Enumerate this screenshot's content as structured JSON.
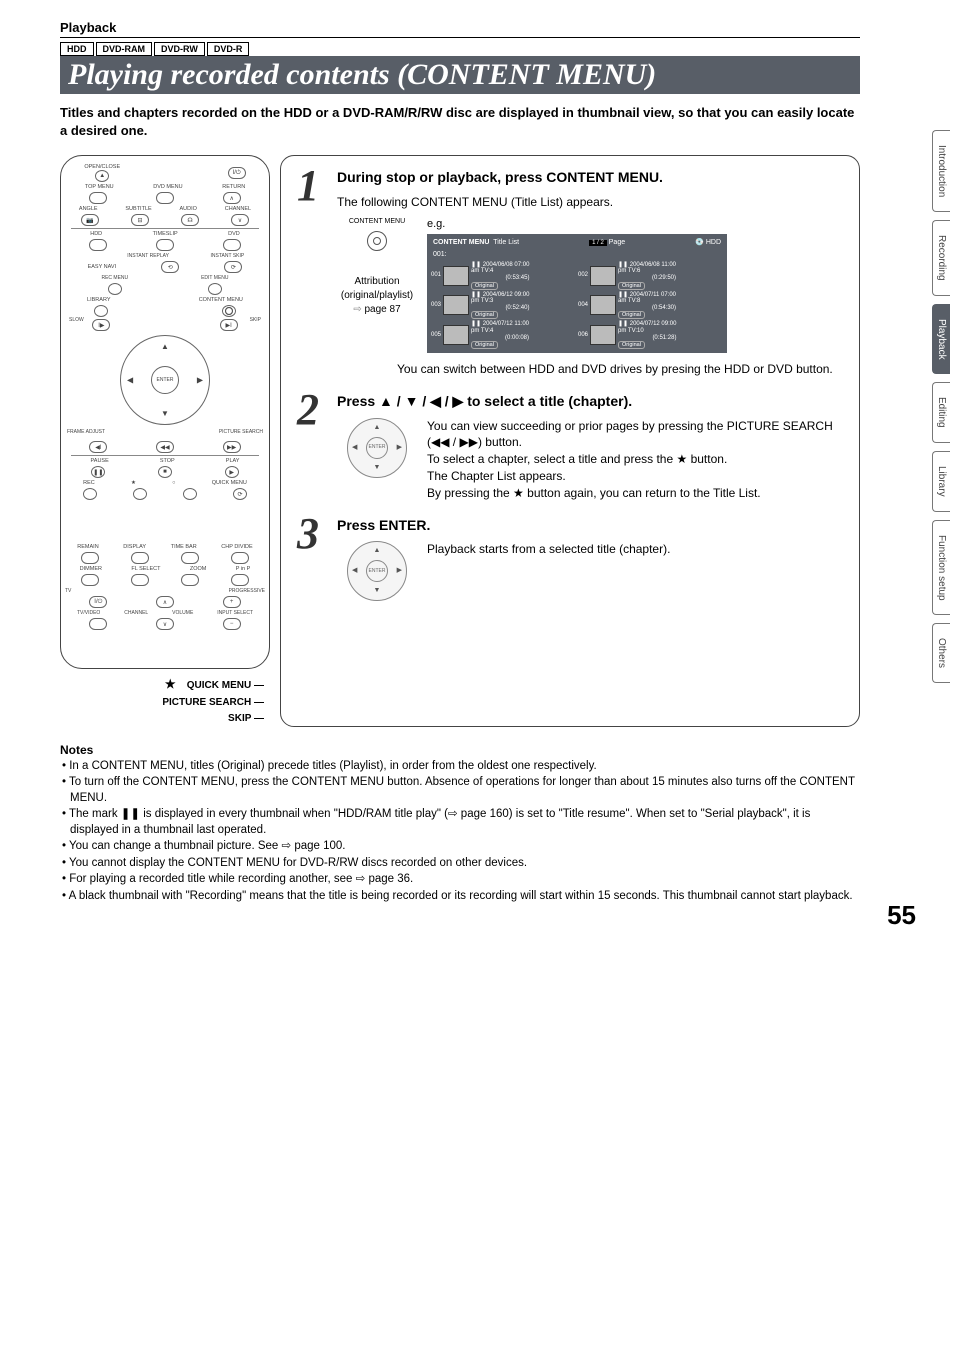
{
  "header": {
    "section": "Playback"
  },
  "media": [
    "HDD",
    "DVD-RAM",
    "DVD-RW",
    "DVD-R"
  ],
  "title": "Playing recorded contents (CONTENT MENU)",
  "intro": "Titles and chapters recorded on the HDD or a DVD-RAM/R/RW disc are displayed in thumbnail view, so that you can easily locate a desired one.",
  "remote": {
    "callouts": {
      "quick": "QUICK MENU",
      "picsearch": "PICTURE SEARCH",
      "skip": "SKIP"
    },
    "labels": {
      "openclose": "OPEN/CLOSE",
      "topmenu": "TOP MENU",
      "dvdmenu": "DVD\nMENU",
      "return": "RETURN",
      "angle": "ANGLE",
      "subtitle": "SUBTITLE",
      "audio": "AUDIO",
      "channel": "CHANNEL",
      "hdd": "HDD",
      "timeslip": "TIMESLIP",
      "dvd": "DVD",
      "instantreplay": "INSTANT REPLAY",
      "instantskip": "INSTANT SKIP",
      "easynavi": "EASY\nNAVI",
      "recmenu": "REC MENU",
      "editmenu": "EDIT MENU",
      "library": "LIBRARY",
      "contentmenu": "CONTENT MENU",
      "enter": "ENTER",
      "slow": "SLOW",
      "skip": "SKIP",
      "frameadjust": "FRAME ADJUST",
      "picturesearch": "PICTURE SEARCH",
      "pause": "PAUSE",
      "stop": "STOP",
      "play": "PLAY",
      "rec": "REC",
      "quickmenu": "QUICK MENU",
      "remain": "REMAIN",
      "display": "DISPLAY",
      "timebar": "TIME BAR",
      "chpdivide": "CHP DIVIDE",
      "dimmer": "DIMMER",
      "flselect": "FL SELECT",
      "zoom": "ZOOM",
      "pinp": "P in P",
      "tv": "TV",
      "progressive": "PROGRESSIVE",
      "tvvideo": "TV/VIDEO",
      "channel2": "CHANNEL",
      "volume": "VOLUME",
      "inputselect": "INPUT SELECT"
    }
  },
  "steps": {
    "s1": {
      "num": "1",
      "head": "During stop or playback, press CONTENT MENU.",
      "line1": "The following CONTENT MENU (Title List) appears.",
      "contentmenu_label": "CONTENT MENU",
      "eg": "e.g.",
      "attribution_l1": "Attribution",
      "attribution_l2": "(original/playlist)",
      "attribution_l3": "page 87",
      "title_list": {
        "header_left": "CONTENT MENU",
        "header_title": "Title List",
        "page_indicator": "1 / 2",
        "page_label": "Page",
        "drive": "HDD",
        "row_num": "001:",
        "cells": [
          {
            "n": "001",
            "date": "2004/06/08 07:00",
            "ch": "am  TV:4",
            "dur": "(0:53:45)",
            "tag": "Original"
          },
          {
            "n": "002",
            "date": "2004/06/08 11:00",
            "ch": "pm  TV:6",
            "dur": "(0:29:50)",
            "tag": "Original"
          },
          {
            "n": "003",
            "date": "2004/06/12 09:00",
            "ch": "pm  TV:3",
            "dur": "(0:52:40)",
            "tag": "Original"
          },
          {
            "n": "004",
            "date": "2004/07/11 07:00",
            "ch": "am  TV:8",
            "dur": "(0:54:30)",
            "tag": "Original"
          },
          {
            "n": "005",
            "date": "2004/07/12 11:00",
            "ch": "pm  TV:4",
            "dur": "(0:00:08)",
            "tag": "Original"
          },
          {
            "n": "006",
            "date": "2004/07/12 09:00",
            "ch": "pm  TV:10",
            "dur": "(0:51:28)",
            "tag": "Original"
          }
        ]
      },
      "after": "You can switch between HDD and DVD drives by presing the HDD or DVD button."
    },
    "s2": {
      "num": "2",
      "head_pre": "Press ",
      "head_post": " to select a title (chapter).",
      "b1": "You can view succeeding or prior pages by pressing the PICTURE SEARCH (",
      "b1b": ") button.",
      "b2": "To select a chapter, select a title and press the ",
      "b2b": " button.",
      "b3": "The Chapter List appears.",
      "b4": "By pressing the ",
      "b4b": " button again, you can return to the Title List."
    },
    "s3": {
      "num": "3",
      "head": "Press ENTER.",
      "body": "Playback starts from a selected title (chapter).",
      "enter": "ENTER"
    }
  },
  "notes": {
    "head": "Notes",
    "items": [
      "In a CONTENT MENU, titles (Original) precede titles (Playlist), in order from the oldest one respectively.",
      "To turn off the CONTENT MENU, press the CONTENT MENU button. Absence of operations for longer than about 15 minutes also turns off the CONTENT MENU.",
      "The mark ❚❚ is displayed in every thumbnail when \"HDD/RAM title play\" (⇨ page 160) is set to \"Title resume\". When set to \"Serial playback\", it is displayed in a thumbnail last operated.",
      "You can change a thumbnail picture. See ⇨ page 100.",
      "You cannot display the CONTENT MENU for DVD-R/RW discs recorded on other devices.",
      "For playing a recorded title while recording another, see ⇨ page 36.",
      "A black thumbnail with \"Recording\" means that the title is being recorded or its recording will start within 15 seconds. This thumbnail cannot start playback."
    ]
  },
  "tabs": [
    "Introduction",
    "Recording",
    "Playback",
    "Editing",
    "Library",
    "Function setup",
    "Others"
  ],
  "active_tab": "Playback",
  "page_number": "55"
}
